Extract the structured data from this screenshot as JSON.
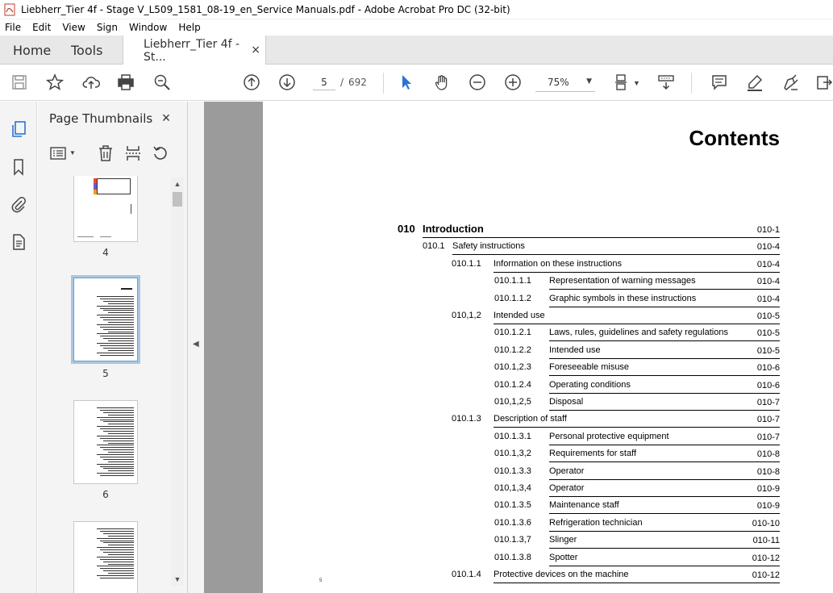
{
  "window": {
    "title": "Liebherr_Tier 4f - Stage V_L509_1581_08-19_en_Service Manuals.pdf - Adobe Acrobat Pro DC (32-bit)"
  },
  "menu": [
    "File",
    "Edit",
    "View",
    "Sign",
    "Window",
    "Help"
  ],
  "tabs": {
    "home": "Home",
    "tools": "Tools",
    "doc": "Liebherr_Tier 4f - St...",
    "close": "×"
  },
  "toolbar": {
    "current_page": "5",
    "separator": "/",
    "total_pages": "692",
    "zoom": "75%",
    "accent": "#2b73d6"
  },
  "panel": {
    "title": "Page Thumbnails",
    "close": "×",
    "thumbs": [
      {
        "label": "4",
        "selected": false
      },
      {
        "label": "5",
        "selected": true
      },
      {
        "label": "6",
        "selected": false
      },
      {
        "label": "",
        "selected": false
      }
    ]
  },
  "document": {
    "title": "Contents",
    "footer_mark": "5",
    "toc": [
      {
        "level": 0,
        "num": "010",
        "text": "Introduction",
        "page": "010-1"
      },
      {
        "level": 1,
        "num": "010.1",
        "text": "Safety instructions",
        "page": "010-4"
      },
      {
        "level": 2,
        "num": "010.1.1",
        "text": "Information on these instructions",
        "page": "010-4"
      },
      {
        "level": 3,
        "num": "010.1.1.1",
        "text": "Representation of warning messages",
        "page": "010-4"
      },
      {
        "level": 3,
        "num": "010.1.1.2",
        "text": "Graphic symbols in these instructions",
        "page": "010-4"
      },
      {
        "level": 2,
        "num": "010,1,2",
        "text": "Intended use",
        "page": "010-5"
      },
      {
        "level": 3,
        "num": "010.1.2.1",
        "text": "Laws, rules, guidelines and safety regulations",
        "page": "010-5"
      },
      {
        "level": 3,
        "num": "010.1.2.2",
        "text": "Intended use",
        "page": "010-5"
      },
      {
        "level": 3,
        "num": "010.1,2.3",
        "text": "Foreseeable misuse",
        "page": "010-6"
      },
      {
        "level": 3,
        "num": "010.1.2.4",
        "text": "Operating conditions",
        "page": "010-6"
      },
      {
        "level": 3,
        "num": "010,1,2,5",
        "text": "Disposal",
        "page": "010-7"
      },
      {
        "level": 2,
        "num": "010.1.3",
        "text": "Description of staff",
        "page": "010-7"
      },
      {
        "level": 3,
        "num": "010.1.3.1",
        "text": "Personal protective equipment",
        "page": "010-7"
      },
      {
        "level": 3,
        "num": "010.1,3,2",
        "text": "Requirements for staff",
        "page": "010-8"
      },
      {
        "level": 3,
        "num": "010.1.3.3",
        "text": "Operator",
        "page": "010-8"
      },
      {
        "level": 3,
        "num": "010,1,3,4",
        "text": "Operator",
        "page": "010-9"
      },
      {
        "level": 3,
        "num": "010.1.3.5",
        "text": "Maintenance staff",
        "page": "010-9"
      },
      {
        "level": 3,
        "num": "010.1.3.6",
        "text": "Refrigeration technician",
        "page": "010-10"
      },
      {
        "level": 3,
        "num": "010.1.3,7",
        "text": "Slinger",
        "page": "010-11"
      },
      {
        "level": 3,
        "num": "010.1.3.8",
        "text": "Spotter",
        "page": "010-12"
      },
      {
        "level": 2,
        "num": "010.1.4",
        "text": "Protective devices on the machine",
        "page": "010-12"
      }
    ]
  }
}
